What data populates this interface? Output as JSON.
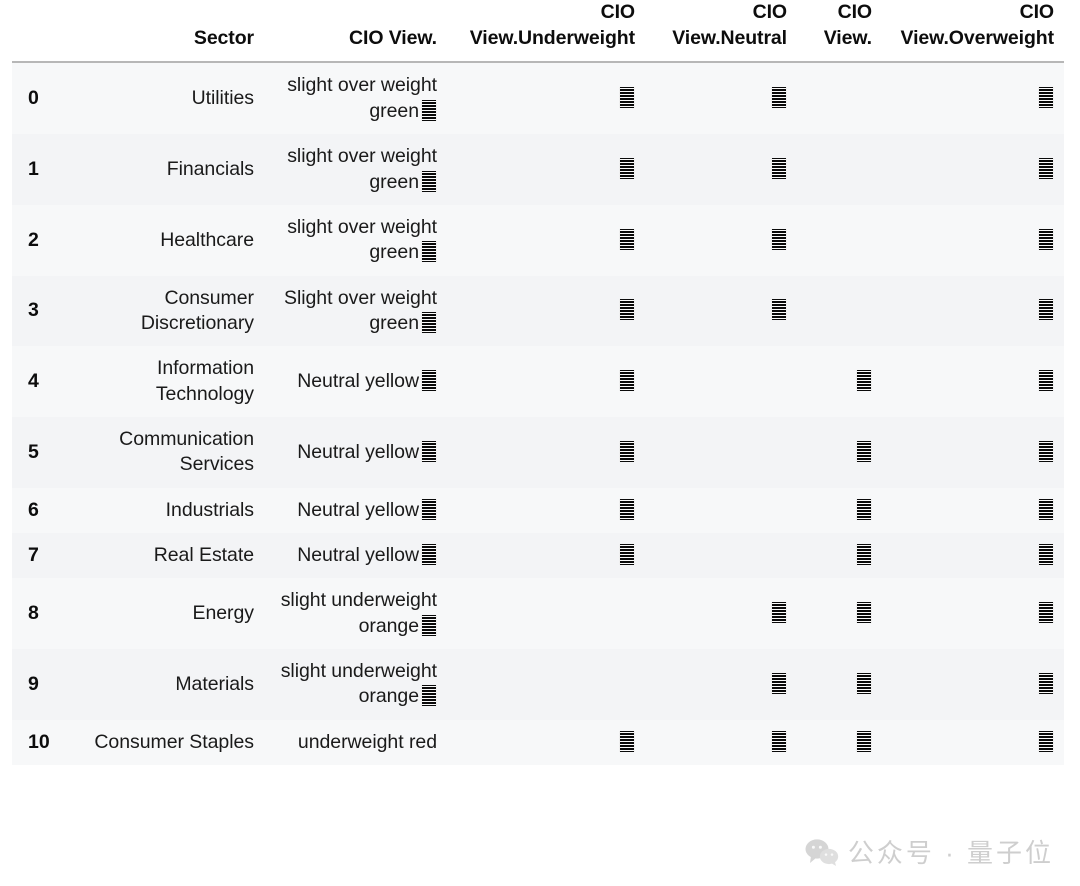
{
  "table": {
    "index_header": "",
    "columns": [
      "Sector",
      "CIO View.",
      "CIO View.Underweight",
      "CIO View.Neutral",
      "CIO View.",
      "CIO View.Overweight"
    ],
    "rows": [
      {
        "index": "0",
        "sector": "Utilities",
        "cio_view": "slight over weight green",
        "cio_view_glyph": "striped-box-icon",
        "underweight": "striped-box-icon",
        "neutral": "striped-box-icon",
        "cio_view_2": "",
        "overweight": "striped-box-icon"
      },
      {
        "index": "1",
        "sector": "Financials",
        "cio_view": "slight over weight green",
        "cio_view_glyph": "striped-box-icon",
        "underweight": "striped-box-icon",
        "neutral": "striped-box-icon",
        "cio_view_2": "",
        "overweight": "striped-box-icon"
      },
      {
        "index": "2",
        "sector": "Healthcare",
        "cio_view": "slight over weight green",
        "cio_view_glyph": "striped-box-icon",
        "underweight": "striped-box-icon",
        "neutral": "striped-box-icon",
        "cio_view_2": "",
        "overweight": "striped-box-icon"
      },
      {
        "index": "3",
        "sector": "Consumer Discretionary",
        "cio_view": "Slight over weight green",
        "cio_view_glyph": "striped-box-icon",
        "underweight": "striped-box-icon",
        "neutral": "striped-box-icon",
        "cio_view_2": "",
        "overweight": "striped-box-icon"
      },
      {
        "index": "4",
        "sector": "Information Technology",
        "cio_view": "Neutral yellow",
        "cio_view_glyph": "striped-box-icon",
        "underweight": "striped-box-icon",
        "neutral": "",
        "cio_view_2": "striped-box-icon",
        "overweight": "striped-box-icon"
      },
      {
        "index": "5",
        "sector": "Communication Services",
        "cio_view": "Neutral yellow",
        "cio_view_glyph": "striped-box-icon",
        "underweight": "striped-box-icon",
        "neutral": "",
        "cio_view_2": "striped-box-icon",
        "overweight": "striped-box-icon"
      },
      {
        "index": "6",
        "sector": "Industrials",
        "cio_view": "Neutral yellow",
        "cio_view_glyph": "striped-box-icon",
        "underweight": "striped-box-icon",
        "neutral": "",
        "cio_view_2": "striped-box-icon",
        "overweight": "striped-box-icon"
      },
      {
        "index": "7",
        "sector": "Real Estate",
        "cio_view": "Neutral yellow",
        "cio_view_glyph": "striped-box-icon",
        "underweight": "striped-box-icon",
        "neutral": "",
        "cio_view_2": "striped-box-icon",
        "overweight": "striped-box-icon"
      },
      {
        "index": "8",
        "sector": "Energy",
        "cio_view": "slight underweight orange",
        "cio_view_glyph": "striped-box-icon",
        "underweight": "",
        "neutral": "striped-box-icon",
        "cio_view_2": "striped-box-icon",
        "overweight": "striped-box-icon"
      },
      {
        "index": "9",
        "sector": "Materials",
        "cio_view": "slight underweight orange",
        "cio_view_glyph": "striped-box-icon",
        "underweight": "",
        "neutral": "striped-box-icon",
        "cio_view_2": "striped-box-icon",
        "overweight": "striped-box-icon"
      },
      {
        "index": "10",
        "sector": "Consumer Staples",
        "cio_view": "underweight red",
        "cio_view_glyph": "",
        "underweight": "striped-box-icon",
        "neutral": "striped-box-icon",
        "cio_view_2": "striped-box-icon",
        "overweight": "striped-box-icon"
      }
    ]
  },
  "watermark": {
    "text": "公众号 · 量子位",
    "icon": "wechat-icon",
    "color": "#8d8d8d"
  },
  "style": {
    "row_odd": "#f7f8f9",
    "row_even": "#f3f4f6",
    "header_rule": "#b7b7b7",
    "text": "#1a1a1a"
  }
}
